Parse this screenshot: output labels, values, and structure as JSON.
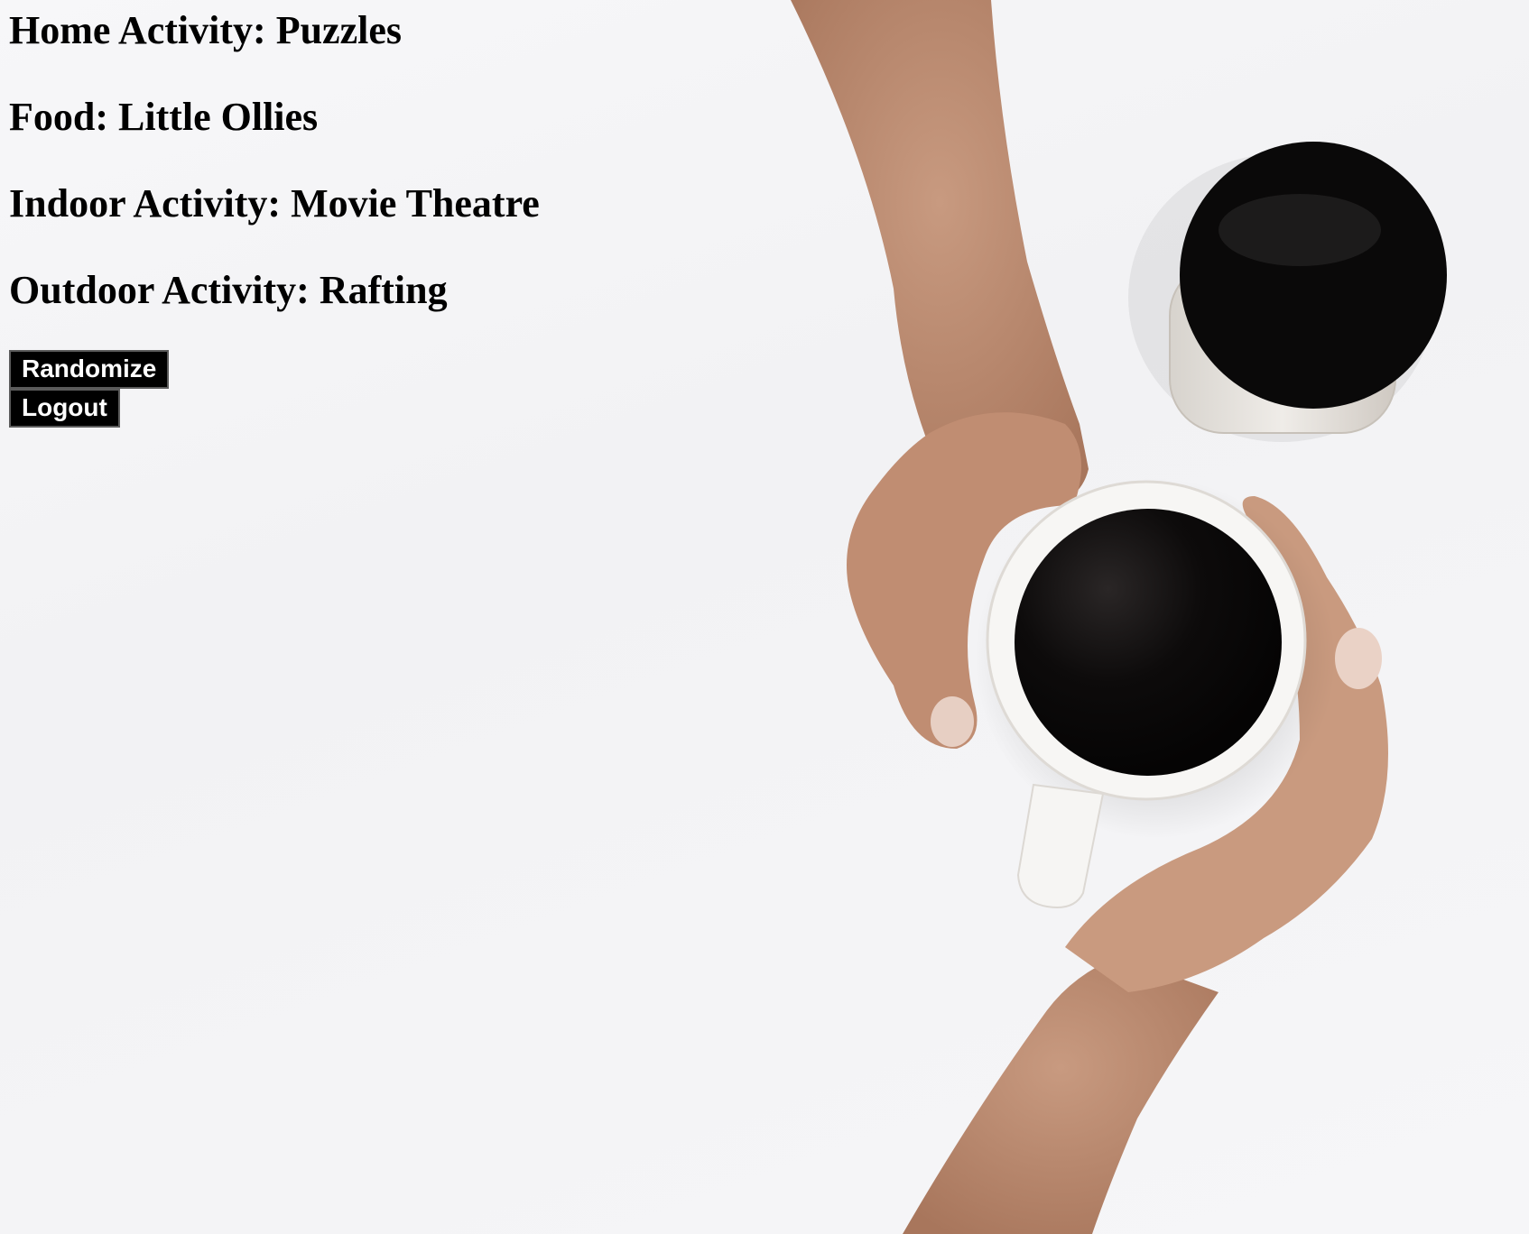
{
  "results": {
    "home_activity": "Home Activity: Puzzles",
    "food": "Food: Little Ollies",
    "indoor_activity": "Indoor Activity: Movie Theatre",
    "outdoor_activity": "Outdoor Activity: Rafting"
  },
  "buttons": {
    "randomize_label": "Randomize",
    "logout_label": "Logout"
  },
  "colors": {
    "text": "#000000",
    "button_background": "#000000",
    "button_text": "#ffffff",
    "coffee": "#0b0909"
  }
}
